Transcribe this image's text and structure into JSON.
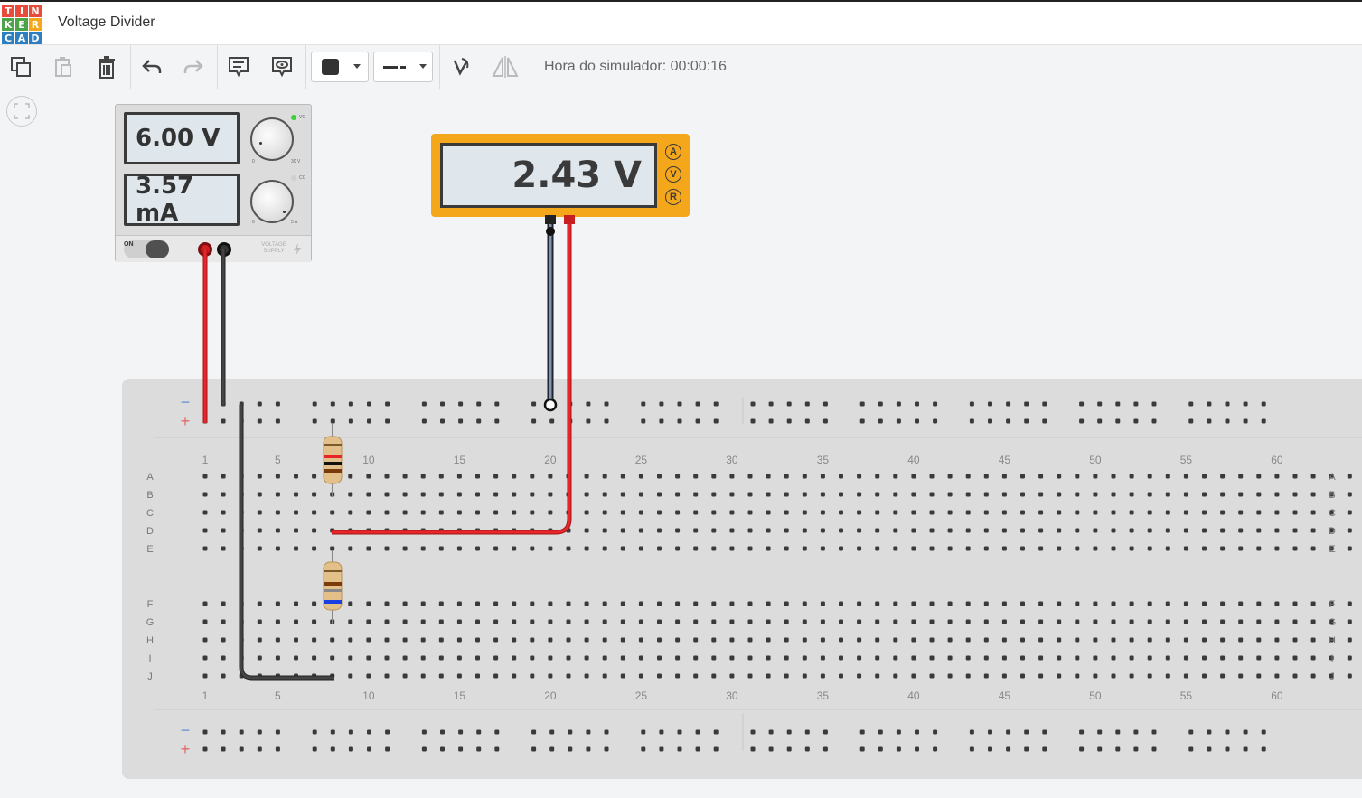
{
  "app": {
    "title": "Voltage Divider",
    "logo_letters": [
      "T",
      "I",
      "N",
      "K",
      "E",
      "R",
      "C",
      "A",
      "D"
    ],
    "logo_colors": [
      "#e84b3c",
      "#e84b3c",
      "#e84b3c",
      "#4da34a",
      "#4da34a",
      "#f5a71c",
      "#2d7fc1",
      "#2d7fc1",
      "#2d7fc1"
    ]
  },
  "toolbar": {
    "buttons": [
      {
        "name": "copy-icon"
      },
      {
        "name": "paste-icon"
      },
      {
        "name": "delete-icon"
      },
      {
        "name": "undo-icon"
      },
      {
        "name": "redo-icon"
      },
      {
        "name": "notes-icon"
      },
      {
        "name": "view-notes-icon"
      },
      {
        "name": "color-dropdown"
      },
      {
        "name": "line-style-dropdown"
      },
      {
        "name": "rotate-icon"
      },
      {
        "name": "flip-icon"
      }
    ],
    "sim_time": "Hora do simulador: 00:00:16"
  },
  "power_supply": {
    "voltage": "6.00 V",
    "current": "3.57 mA",
    "voltage_knob_range": [
      "0",
      "30 V"
    ],
    "current_knob_range": [
      "0",
      "5 A"
    ],
    "cv_label": "VC",
    "cc_label": "CC",
    "switch_label": "ON",
    "brand": "VOLTAGE SUPPLY"
  },
  "multimeter": {
    "reading": "2.43 V",
    "modes": [
      "A",
      "V",
      "R"
    ],
    "selected_mode": "V"
  },
  "breadboard": {
    "columns": [
      "1",
      "5",
      "10",
      "15",
      "20",
      "25",
      "30",
      "35",
      "40",
      "45",
      "50",
      "55",
      "60"
    ],
    "rows_top": [
      "A",
      "B",
      "C",
      "D",
      "E"
    ],
    "rows_bottom": [
      "F",
      "G",
      "H",
      "I",
      "J"
    ],
    "rail_minus": "−",
    "rail_plus": "+"
  },
  "colors": {
    "wire_red": "#e8262a",
    "wire_black": "#333333",
    "multimeter_body": "#f5a71c",
    "lcd_bg": "#dfe7ec"
  }
}
